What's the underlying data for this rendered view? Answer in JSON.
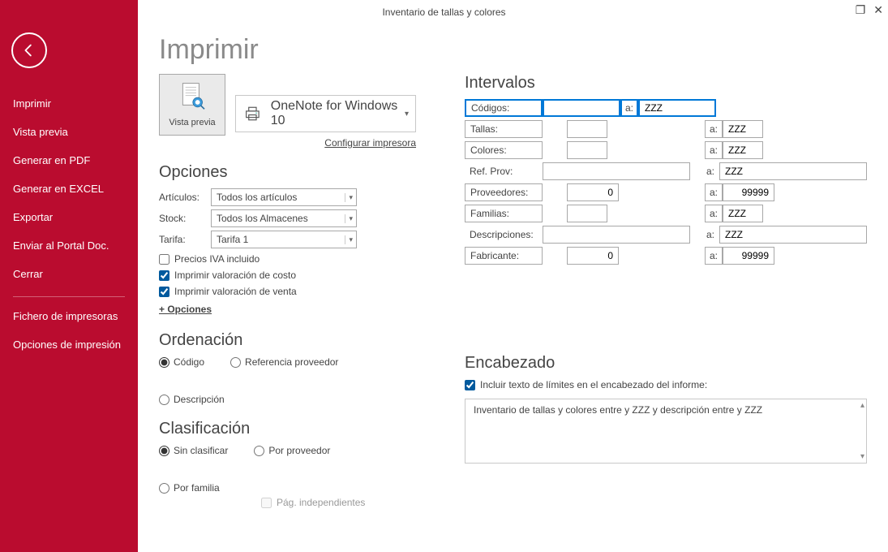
{
  "window": {
    "title": "Inventario de tallas y colores"
  },
  "sidebar": {
    "items": [
      "Imprimir",
      "Vista previa",
      "Generar en PDF",
      "Generar en EXCEL",
      "Exportar",
      "Enviar al Portal Doc.",
      "Cerrar"
    ],
    "secondary": [
      "Fichero de impresoras",
      "Opciones de impresión"
    ]
  },
  "page": {
    "title": "Imprimir",
    "preview_label": "Vista previa",
    "printer": "OneNote for Windows 10",
    "config_link": "Configurar impresora"
  },
  "options": {
    "heading": "Opciones",
    "articulos_label": "Artículos:",
    "articulos_value": "Todos los artículos",
    "stock_label": "Stock:",
    "stock_value": "Todos los Almacenes",
    "tarifa_label": "Tarifa:",
    "tarifa_value": "Tarifa 1",
    "chk_iva": "Precios IVA incluido",
    "chk_costo": "Imprimir valoración de costo",
    "chk_venta": "Imprimir valoración de venta",
    "more": "+ Opciones"
  },
  "orden": {
    "heading": "Ordenación",
    "codigo": "Código",
    "ref": "Referencia proveedor",
    "desc": "Descripción"
  },
  "clasif": {
    "heading": "Clasificación",
    "sin": "Sin clasificar",
    "prov": "Por proveedor",
    "fam": "Por familia",
    "pag": "Pág. independientes"
  },
  "intervalos": {
    "heading": "Intervalos",
    "a": "a:",
    "codigos": {
      "label": "Códigos:",
      "from": "",
      "to": "ZZZ"
    },
    "tallas": {
      "label": "Tallas:",
      "from": "",
      "to": "ZZZ"
    },
    "colores": {
      "label": "Colores:",
      "from": "",
      "to": "ZZZ"
    },
    "refprov": {
      "label": "Ref. Prov:",
      "from": "",
      "to": "ZZZ"
    },
    "proveedores": {
      "label": "Proveedores:",
      "from": "0",
      "to": "99999"
    },
    "familias": {
      "label": "Familias:",
      "from": "",
      "to": "ZZZ"
    },
    "descrip": {
      "label": "Descripciones:",
      "from": "",
      "to": "ZZZ"
    },
    "fabricante": {
      "label": "Fabricante:",
      "from": "0",
      "to": "99999"
    }
  },
  "encabezado": {
    "heading": "Encabezado",
    "chk": "Incluir texto de límites en el encabezado del informe:",
    "text": "Inventario de tallas y colores entre  y ZZZ y descripción entre  y ZZZ"
  }
}
